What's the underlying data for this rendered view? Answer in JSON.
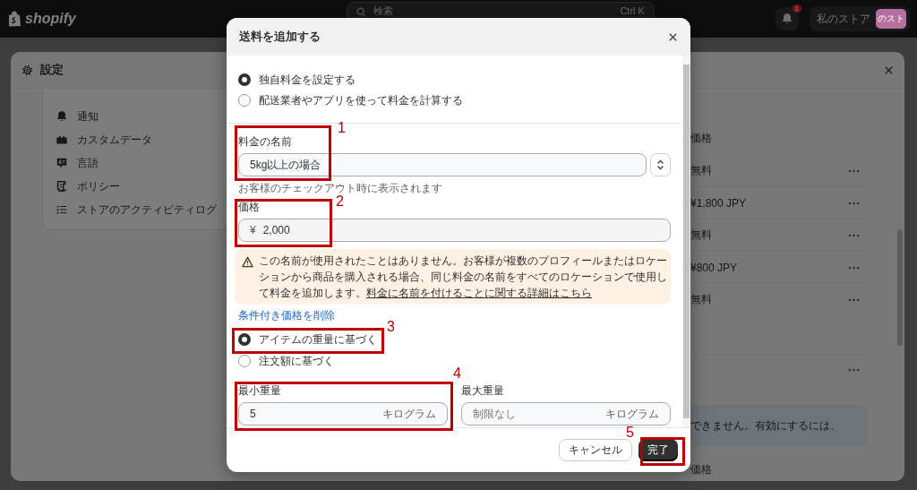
{
  "topbar": {
    "logo": "shopify",
    "search": {
      "placeholder": "検索",
      "shortcut": "Ctrl K"
    },
    "notifications": {
      "count": "1"
    },
    "store": {
      "name": "私のストア",
      "avatar": "のスト"
    }
  },
  "settings": {
    "title": "設定",
    "nav": [
      {
        "label": "通知",
        "kind": "bell"
      },
      {
        "label": "カスタムデータ",
        "kind": "blocks"
      },
      {
        "label": "言語",
        "kind": "language"
      },
      {
        "label": "ポリシー",
        "kind": "policy"
      },
      {
        "label": "ストアのアクティビティログ",
        "kind": "list"
      }
    ],
    "table": {
      "header": "価格",
      "rows": [
        {
          "price": "無料"
        },
        {
          "price": "¥1,800 JPY"
        },
        {
          "price": "無料"
        },
        {
          "price": "¥800 JPY"
        },
        {
          "price": "無料"
        }
      ]
    },
    "banner": "できません。有効にするには、",
    "footer_header": "価格"
  },
  "dialog": {
    "title": "送料を追加する",
    "rate_type": [
      {
        "label": "独自料金を設定する",
        "selected": true
      },
      {
        "label": "配送業者やアプリを使って料金を計算する",
        "selected": false
      }
    ],
    "rate_name": {
      "label": "料金の名前",
      "value": "5kg以上の場合",
      "help": "お客様のチェックアウト時に表示されます"
    },
    "price": {
      "label": "価格",
      "prefix": "¥",
      "value": "2,000"
    },
    "warning": {
      "text": "この名前が使用されたことはありません。お客様が複数のプロフィールまたはロケーションから商品を購入される場合、同じ料金の名前をすべてのロケーションで使用して料金を追加します。",
      "link": "料金に名前を付けることに関する詳細はこちら"
    },
    "remove_link": "条件付き価格を削除",
    "condition": [
      {
        "label": "アイテムの重量に基づく",
        "selected": true
      },
      {
        "label": "注文額に基づく",
        "selected": false
      }
    ],
    "min_weight": {
      "label": "最小重量",
      "value": "5",
      "unit": "キログラム"
    },
    "max_weight": {
      "label": "最大重量",
      "placeholder": "制限なし",
      "unit": "キログラム"
    },
    "buttons": [
      {
        "label": "キャンセル",
        "kind": "secondary"
      },
      {
        "label": "完了",
        "kind": "primary"
      }
    ]
  },
  "annotations": [
    {
      "number": "1"
    },
    {
      "number": "2"
    },
    {
      "number": "3"
    },
    {
      "number": "4"
    },
    {
      "number": "5"
    }
  ]
}
